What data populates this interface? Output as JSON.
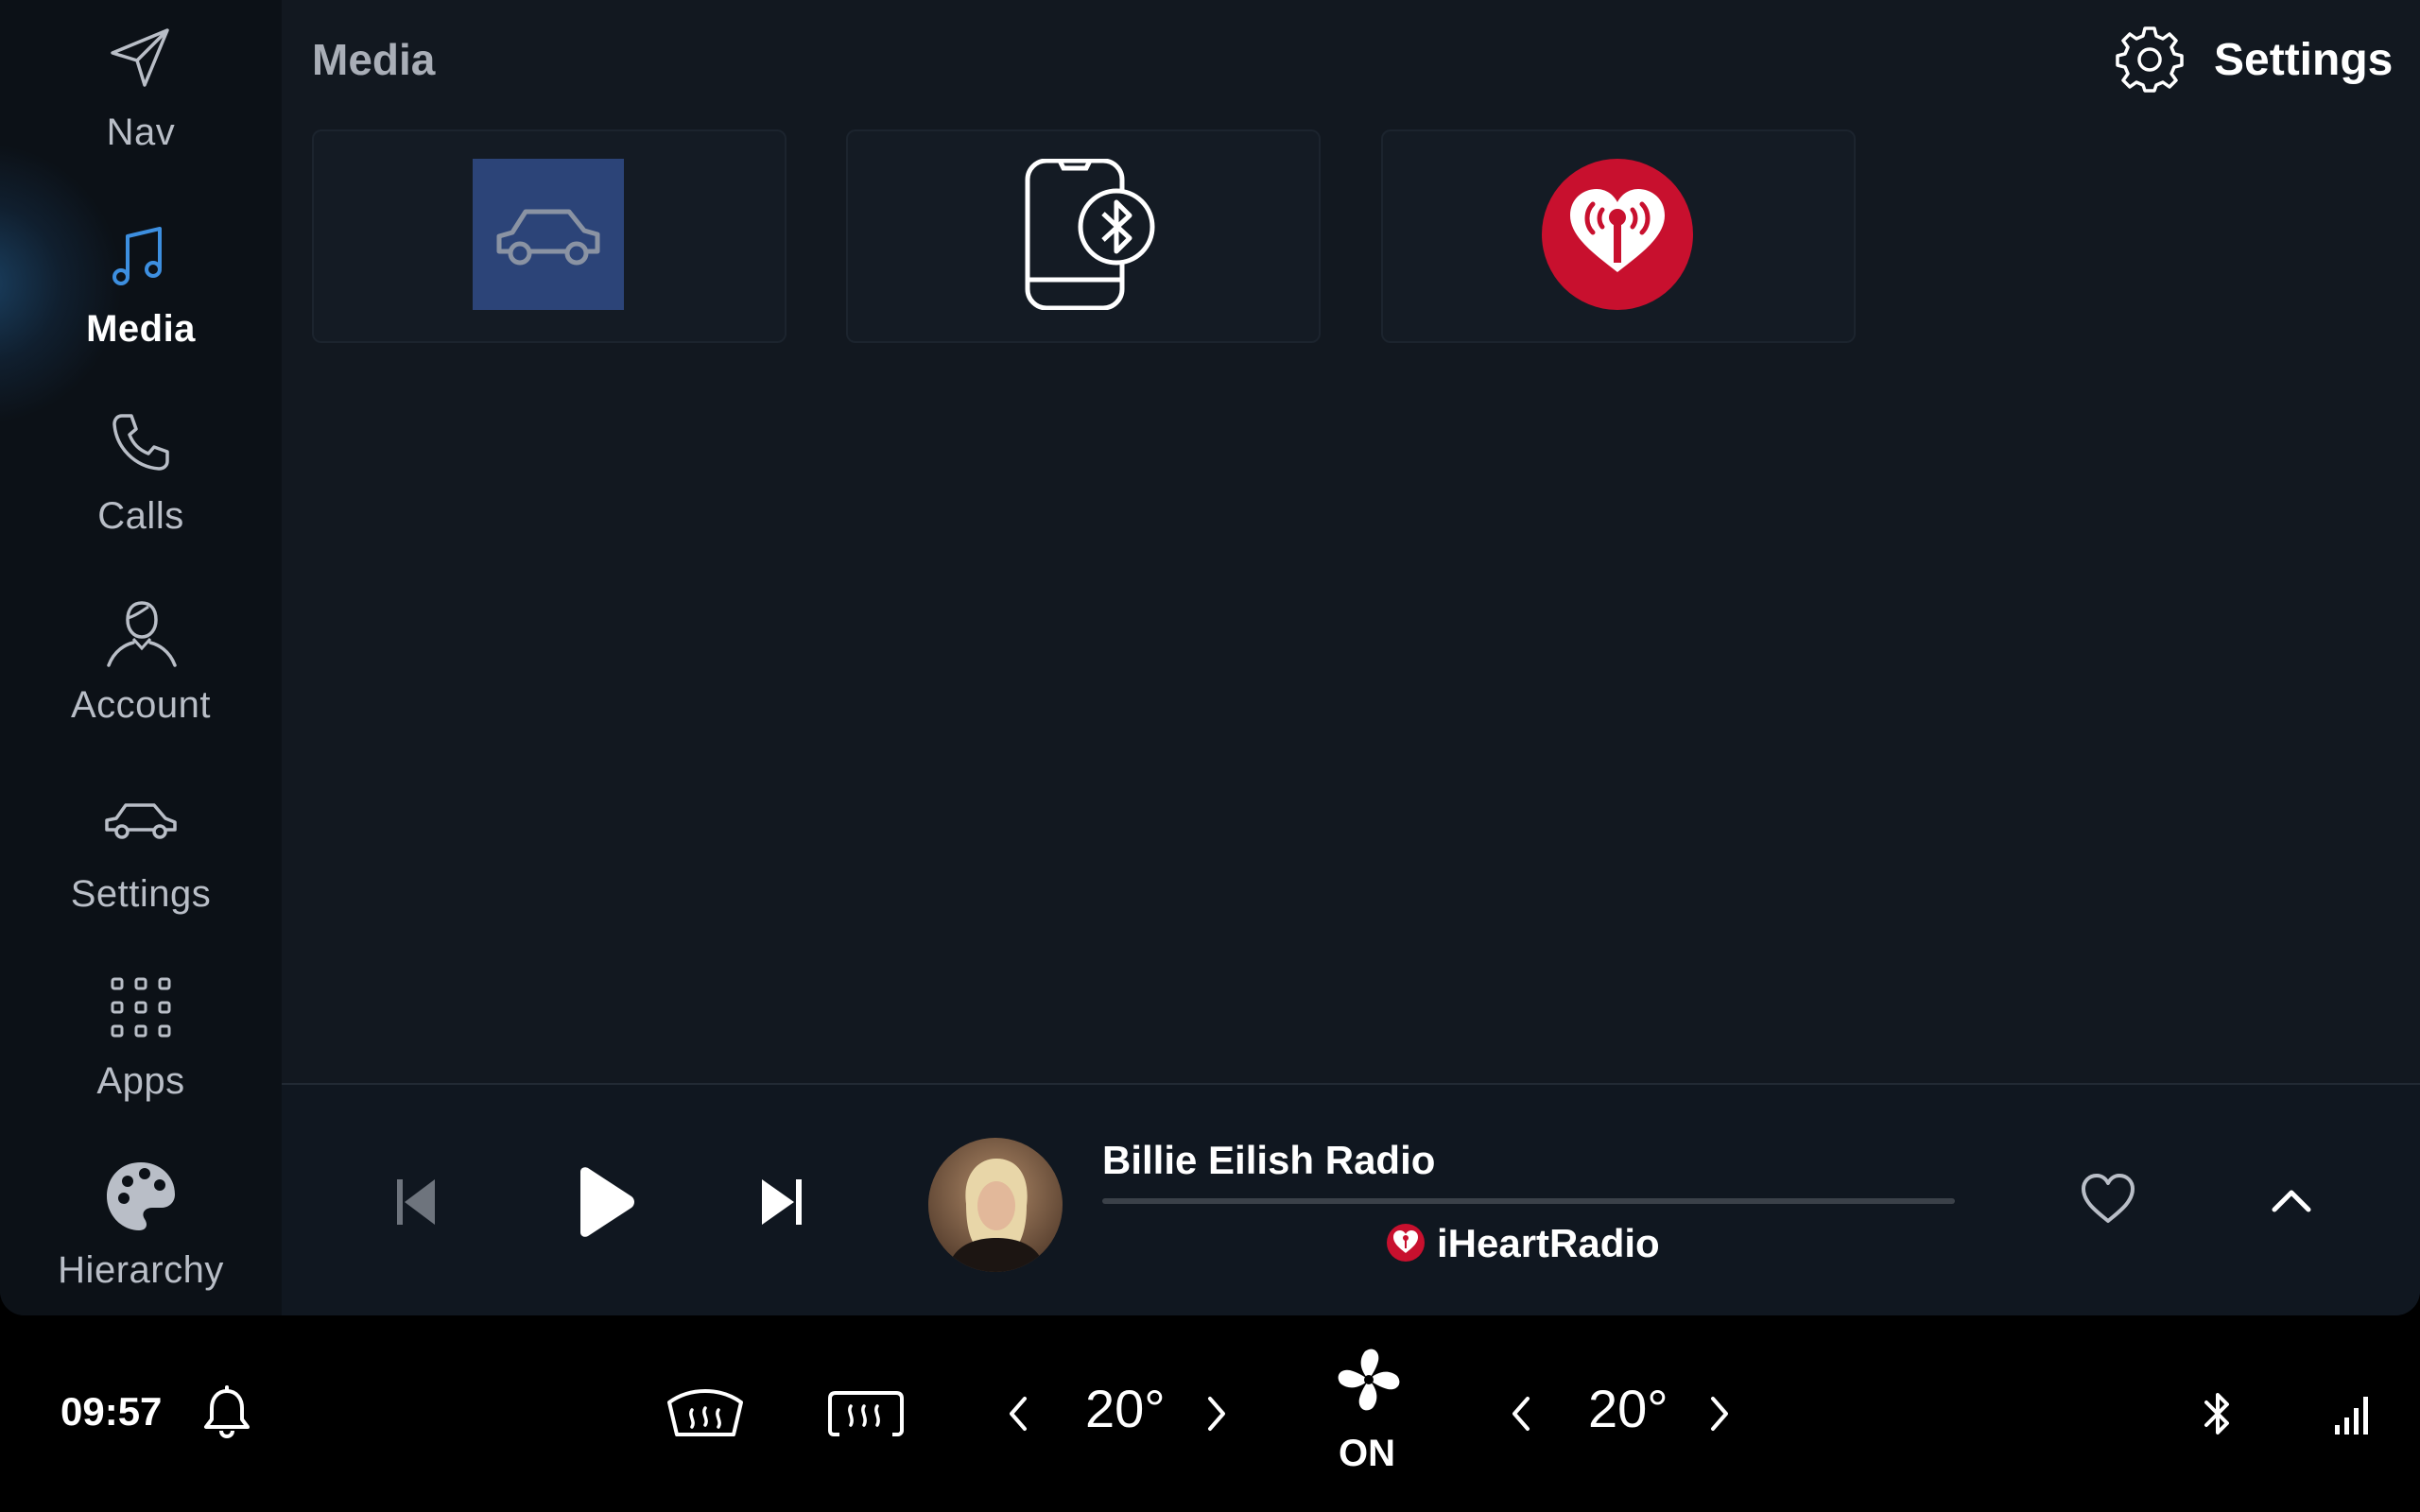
{
  "header": {
    "title": "Media",
    "settings_label": "Settings"
  },
  "nav": {
    "items": [
      {
        "label": "Nav",
        "icon": "navigation-arrow-icon",
        "active": false
      },
      {
        "label": "Media",
        "icon": "music-note-icon",
        "active": true
      },
      {
        "label": "Calls",
        "icon": "phone-icon",
        "active": false
      },
      {
        "label": "Account",
        "icon": "user-icon",
        "active": false
      },
      {
        "label": "Settings",
        "icon": "car-icon",
        "active": false
      },
      {
        "label": "Apps",
        "icon": "app-grid-icon",
        "active": false
      },
      {
        "label": "Hierarchy",
        "icon": "palette-icon",
        "active": false
      }
    ]
  },
  "sources": [
    {
      "icon": "car-radio-icon"
    },
    {
      "icon": "bluetooth-phone-icon"
    },
    {
      "icon": "iheartradio-icon"
    }
  ],
  "player": {
    "track_title": "Billie Eilish Radio",
    "source_name": "iHeartRadio",
    "progress": 0,
    "liked": false
  },
  "climate": {
    "left_temp": "20°",
    "right_temp": "20°",
    "fan_status": "ON"
  },
  "status": {
    "time": "09:57"
  },
  "colors": {
    "accent": "#3d8fe0",
    "iheart_red": "#c8102e",
    "background": "#121820",
    "rail": "#0c1117"
  }
}
